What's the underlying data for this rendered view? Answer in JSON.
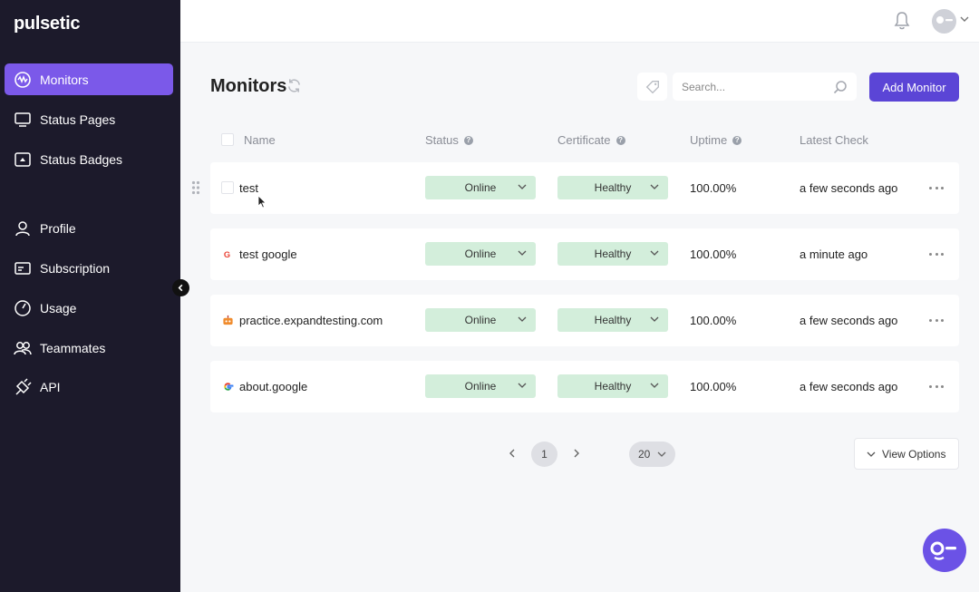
{
  "app": {
    "logo": "pulsetic"
  },
  "sidebar": {
    "items": [
      {
        "label": "Monitors",
        "icon": "monitors-icon",
        "active": true
      },
      {
        "label": "Status Pages",
        "icon": "monitor-screen-icon"
      },
      {
        "label": "Status Badges",
        "icon": "badge-icon"
      },
      {
        "label": "Profile",
        "icon": "user-icon"
      },
      {
        "label": "Subscription",
        "icon": "card-icon"
      },
      {
        "label": "Usage",
        "icon": "gauge-icon"
      },
      {
        "label": "Teammates",
        "icon": "users-icon"
      },
      {
        "label": "API",
        "icon": "plug-icon"
      }
    ]
  },
  "header": {
    "title": "Monitors",
    "search_placeholder": "Search...",
    "add_label": "Add Monitor"
  },
  "table": {
    "columns": {
      "name": "Name",
      "status": "Status",
      "certificate": "Certificate",
      "uptime": "Uptime",
      "latest": "Latest Check"
    },
    "rows": [
      {
        "name": "test",
        "status": "Online",
        "certificate": "Healthy",
        "uptime": "100.00%",
        "latest": "a few seconds ago",
        "favicon": "none"
      },
      {
        "name": "test google",
        "status": "Online",
        "certificate": "Healthy",
        "uptime": "100.00%",
        "latest": "a minute ago",
        "favicon": "google-small-icon"
      },
      {
        "name": "practice.expandtesting.com",
        "status": "Online",
        "certificate": "Healthy",
        "uptime": "100.00%",
        "latest": "a few seconds ago",
        "favicon": "robot-icon"
      },
      {
        "name": "about.google",
        "status": "Online",
        "certificate": "Healthy",
        "uptime": "100.00%",
        "latest": "a few seconds ago",
        "favicon": "google-icon"
      }
    ]
  },
  "pagination": {
    "current": "1",
    "per_page": "20"
  },
  "view_options_label": "View Options",
  "colors": {
    "sidebar": "#1c1a2b",
    "accent": "#5b45d6",
    "active_nav": "#7b59e9",
    "pill": "#d3eedb"
  }
}
